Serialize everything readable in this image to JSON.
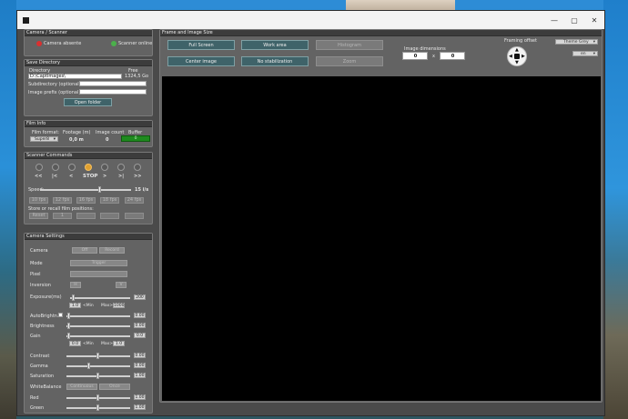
{
  "camera_scanner": {
    "title": "Camera / Scanner",
    "camera_status": "Camera absente",
    "scanner_status": "Scanner online",
    "camera_color": "#d93030",
    "scanner_color": "#4bb04b"
  },
  "save_directory": {
    "title": "Save Directory",
    "directory_label": "Directory",
    "free_label": "Free",
    "directory_value": "D:\\CaptImages\\",
    "free_value": "1324,5 Go",
    "subdirectory_label": "Subdirectory (optional):",
    "image_prefix_label": "Image prefix (optional):",
    "open_folder": "Open folder"
  },
  "film_info": {
    "title": "Film Info",
    "format_label": "Film format:",
    "footage_label": "Footage (m)",
    "count_label": "Image count",
    "buffer_label": "Buffer",
    "format_value": "Super8",
    "footage_value": "0,0 m",
    "count_value": "0",
    "buffer_value": "0"
  },
  "scanner_commands": {
    "title": "Scanner Commands",
    "nav": [
      "<<",
      "|<",
      "<",
      "STOP",
      ">",
      ">|",
      ">>"
    ],
    "speed_label": "Speed:",
    "speed_value": "15 i/s",
    "fps": [
      "10 fps",
      "12 fps",
      "16 fps",
      "18 fps",
      "24 fps"
    ],
    "store_label": "Store or recall film positions:",
    "reset": "Reset",
    "positions": [
      "1",
      "",
      "",
      ""
    ]
  },
  "camera_settings": {
    "title": "Camera Settings",
    "camera_label": "Camera",
    "off": "Off",
    "record": "Record",
    "mode_label": "Mode",
    "trigger": "Trigger",
    "pixel_label": "Pixel",
    "inversion_label": "Inversion",
    "h": "H",
    "v": "V",
    "exposure_label": "Exposure(ms)",
    "exposure_value": "200",
    "exp_min": "1.0",
    "exp_min_label": "<Min",
    "exp_max_label": "Max>",
    "exp_max": "1000",
    "autobrightness_label": "AutoBrightn.",
    "autobrightness_value": "0.00",
    "brightness_label": "Brightness",
    "brightness_value": "0.00",
    "gain_label": "Gain",
    "gain_value": "0.0",
    "gain_min": "0.0",
    "gain_min_label": "<Min",
    "gain_max_label": "Max>",
    "gain_max": "1.0",
    "contrast_label": "Contrast",
    "contrast_value": "0.00",
    "gamma_label": "Gamma",
    "gamma_value": "0.00",
    "saturation_label": "Saturation",
    "saturation_value": "1.00",
    "whitebalance_label": "WhiteBalance",
    "continuous": "Continuous",
    "once": "Once",
    "red_label": "Red",
    "red_value": "1.00",
    "green_label": "Green",
    "green_value": "1.00"
  },
  "frame": {
    "title": "Frame and Image Size",
    "full_screen": "Full Screen",
    "work_area": "Work area",
    "histogram": "Histogram",
    "center_image": "Center image",
    "no_stabilization": "No stabilization",
    "zoom": "Zoom",
    "dimensions_label": "Image dimensions",
    "width_value": "0",
    "x_label": "x",
    "height_value": "0",
    "framing_label": "Framing offset",
    "theme": "Theme Grey",
    "lang": "en"
  },
  "window": {
    "controls": [
      "—",
      "▢",
      "✕"
    ]
  },
  "colors": {
    "accent_teal": "#3f6369",
    "buffer_green": "#1f8a1f",
    "stop_orange": "#e0a030"
  }
}
